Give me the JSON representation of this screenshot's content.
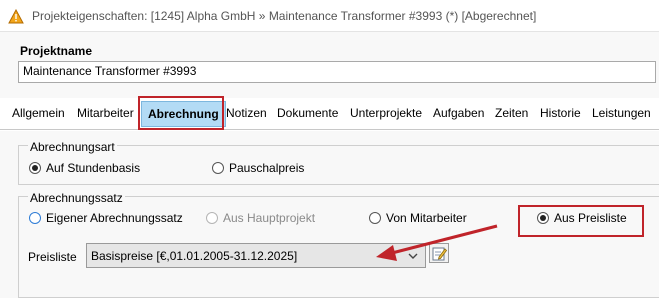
{
  "window": {
    "title": "Projekteigenschaften: [1245] Alpha GmbH » Maintenance Transformer #3993 (*) [Abgerechnet]",
    "icon": "warning-icon"
  },
  "project": {
    "name_label": "Projektname",
    "name_value": "Maintenance Transformer #3993"
  },
  "tabs": [
    {
      "label": "Allgemein"
    },
    {
      "label": "Mitarbeiter"
    },
    {
      "label": "Abrechnung",
      "active": true
    },
    {
      "label": "Notizen"
    },
    {
      "label": "Dokumente"
    },
    {
      "label": "Unterprojekte"
    },
    {
      "label": "Aufgaben"
    },
    {
      "label": "Zeiten"
    },
    {
      "label": "Historie"
    },
    {
      "label": "Leistungen"
    }
  ],
  "billing_type": {
    "title": "Abrechnungsart",
    "options": [
      {
        "label": "Auf Stundenbasis",
        "checked": true
      },
      {
        "label": "Pauschalpreis",
        "checked": false
      }
    ]
  },
  "billing_rate": {
    "title": "Abrechnungssatz",
    "options": [
      {
        "label": "Eigener Abrechnungssatz",
        "checked": false
      },
      {
        "label": "Aus Hauptprojekt",
        "checked": false,
        "disabled": true
      },
      {
        "label": "Von Mitarbeiter",
        "checked": false
      },
      {
        "label": "Aus Preisliste",
        "checked": true
      }
    ]
  },
  "pricelist": {
    "label": "Preisliste",
    "selected": "Basispreise [€,01.01.2005-31.12.2025]",
    "edit_icon": "edit-icon"
  },
  "colors": {
    "annotation_red": "#c0242a",
    "tab_active_bg": "#b3dbf5",
    "radio_focus_blue": "#2e7cd6"
  }
}
